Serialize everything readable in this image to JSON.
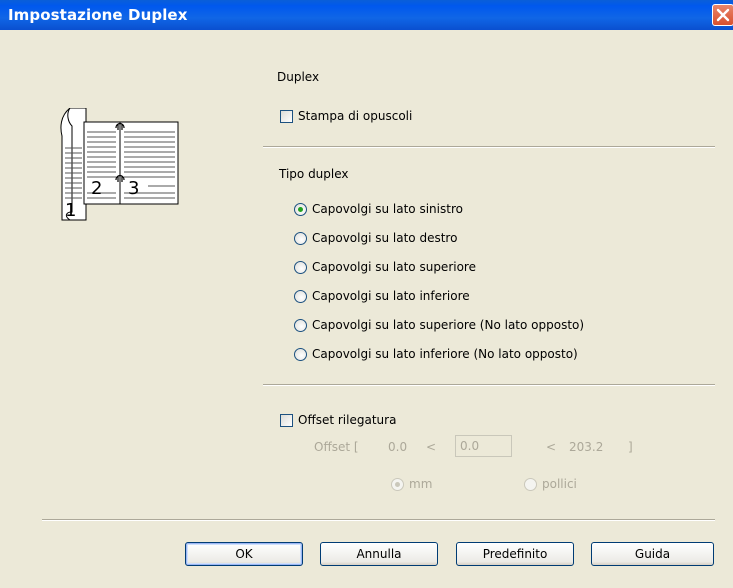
{
  "window": {
    "title": "Impostazione Duplex"
  },
  "duplex": {
    "section_label": "Duplex",
    "booklet_label": "Stampa di opuscoli",
    "booklet_checked": false
  },
  "illustration": {
    "page_numbers": [
      "1",
      "2",
      "3"
    ]
  },
  "duplex_type": {
    "section_label": "Tipo duplex",
    "options": [
      {
        "label": "Capovolgi su lato sinistro",
        "checked": true
      },
      {
        "label": "Capovolgi su lato destro",
        "checked": false
      },
      {
        "label": "Capovolgi su lato superiore",
        "checked": false
      },
      {
        "label": "Capovolgi su lato inferiore",
        "checked": false
      },
      {
        "label": "Capovolgi su lato superiore (No lato opposto)",
        "checked": false
      },
      {
        "label": "Capovolgi su lato inferiore (No lato opposto)",
        "checked": false
      }
    ]
  },
  "binding_offset": {
    "label": "Offset rilegatura",
    "checked": false,
    "offset_label": "Offset [",
    "min": "0.0",
    "lt1": "<",
    "value": "0.0",
    "lt2": "<",
    "max": "203.2",
    "close_bracket": "]",
    "units": [
      {
        "label": "mm",
        "checked": true
      },
      {
        "label": "pollici",
        "checked": false
      }
    ]
  },
  "buttons": {
    "ok": "OK",
    "cancel": "Annulla",
    "default": "Predefinito",
    "help": "Guida"
  },
  "colors": {
    "title_bar": "#0058ee",
    "dialog_bg": "#ece9d8",
    "radio_selected": "#21a121"
  },
  "icons": {
    "close": "close-icon"
  }
}
